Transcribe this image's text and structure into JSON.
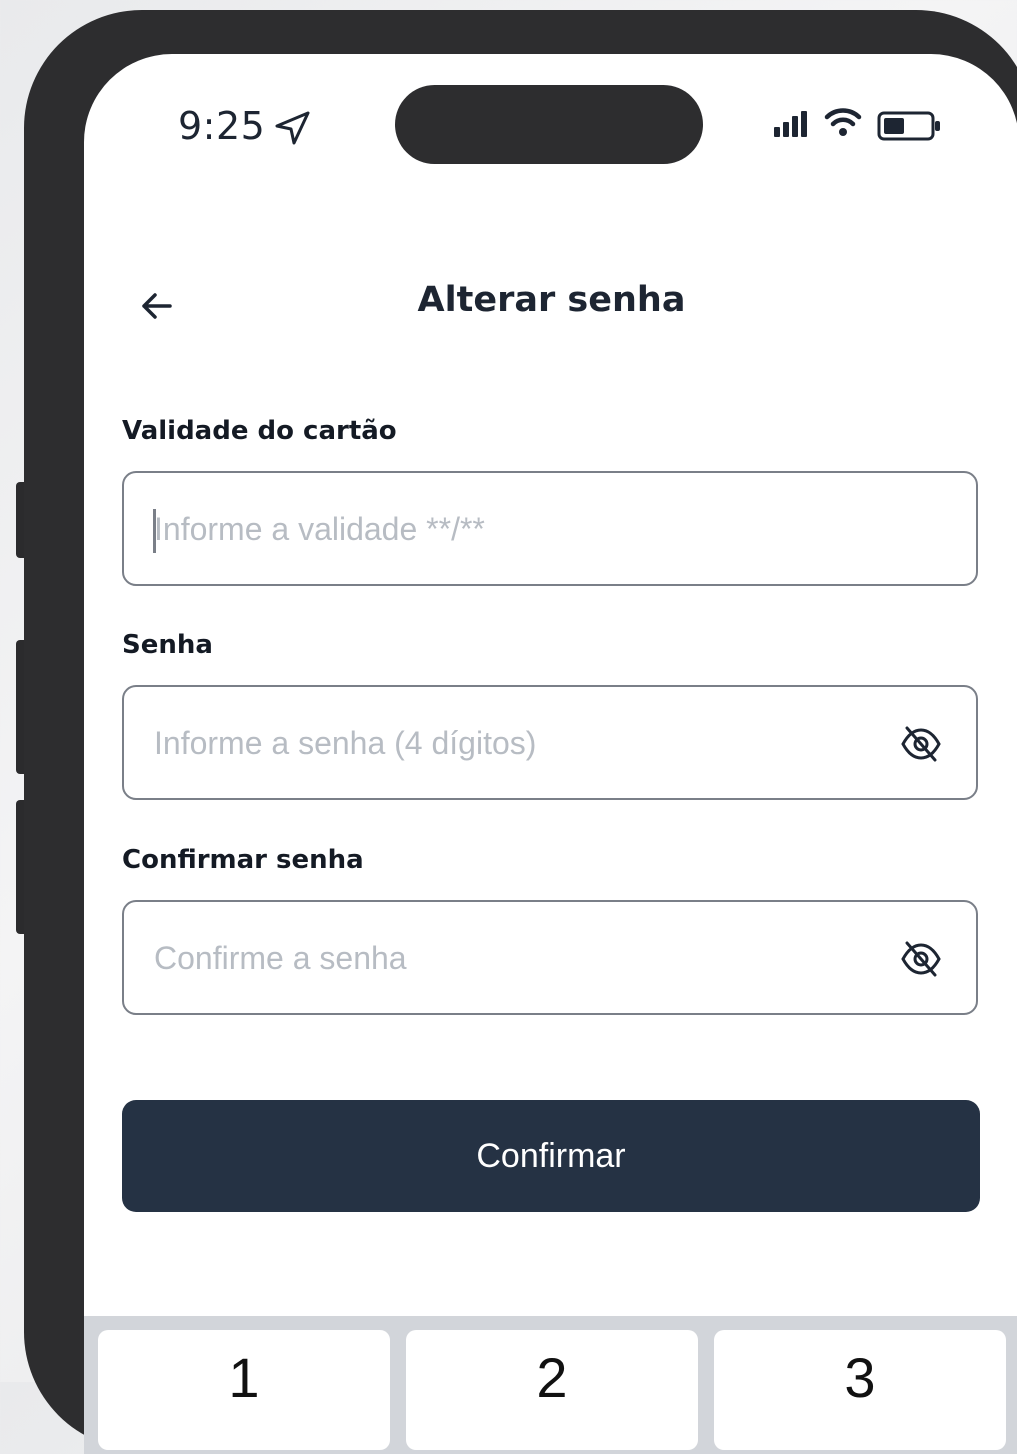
{
  "status_bar": {
    "time": "9:25"
  },
  "header": {
    "title": "Alterar senha"
  },
  "form": {
    "expiry": {
      "label": "Validade do cartão",
      "placeholder": "Informe a validade **/**"
    },
    "password": {
      "label": "Senha",
      "placeholder": "Informe a senha (4 dígitos)"
    },
    "confirm_password": {
      "label": "Confirmar senha",
      "placeholder": "Confirme a senha"
    },
    "submit_label": "Confirmar"
  },
  "keyboard": {
    "keys": [
      "1",
      "2",
      "3"
    ]
  },
  "colors": {
    "primary_button": "#253244",
    "text": "#1d2532",
    "placeholder": "#b7bcc3"
  }
}
